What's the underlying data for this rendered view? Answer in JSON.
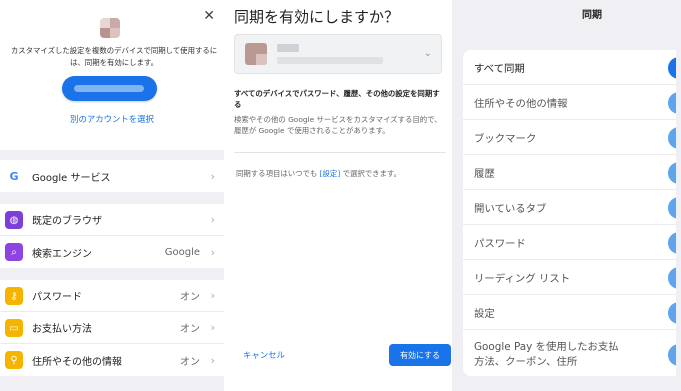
{
  "left": {
    "close_icon": "close-icon",
    "signin_text": "カスタマイズした設定を複数のデバイスで同期して使用するには、同期を有効にします。",
    "other_account": "別のアカウントを選択",
    "sections": [
      {
        "rows": [
          {
            "name": "google-services",
            "icon": "google-icon",
            "icon_glyph": "G",
            "icon_color": "#ffffff",
            "label": "Google サービス",
            "value": ""
          }
        ]
      },
      {
        "rows": [
          {
            "name": "default-browser",
            "icon": "browser-icon",
            "icon_glyph": "◍",
            "icon_color": "#7e3fd8",
            "label": "既定のブラウザ",
            "value": ""
          },
          {
            "name": "search-engine",
            "icon": "search-icon",
            "icon_glyph": "⌕",
            "icon_color": "#8e44e0",
            "label": "検索エンジン",
            "value": "Google"
          }
        ]
      },
      {
        "rows": [
          {
            "name": "passwords",
            "icon": "key-icon",
            "icon_glyph": "⚷",
            "icon_color": "#f4b400",
            "label": "パスワード",
            "value": "オン"
          },
          {
            "name": "payment-methods",
            "icon": "card-icon",
            "icon_glyph": "▭",
            "icon_color": "#f4b400",
            "label": "お支払い方法",
            "value": "オン"
          },
          {
            "name": "addresses",
            "icon": "location-pin-icon",
            "icon_glyph": "⚲",
            "icon_color": "#f4b400",
            "label": "住所やその他の情報",
            "value": "オン"
          }
        ]
      }
    ]
  },
  "dialog": {
    "title": "同期を有効にしますか？",
    "sync_bold": "すべてのデバイスでパスワード、履歴、その他の設定を同期する",
    "sync_desc": "検索やその他の Google サービスをカスタマイズする目的で、履歴が Google で使用されることがあります。",
    "note_prefix": "同期する項目はいつでも ",
    "note_link": "[設定]",
    "note_suffix": " で選択できます。",
    "cancel": "キャンセル",
    "enable": "有効にする"
  },
  "sync_settings": {
    "title": "同期",
    "items": [
      {
        "label": "すべて同期",
        "on": true,
        "strong": true
      },
      {
        "label": "住所やその他の情報",
        "on": true,
        "strong": false
      },
      {
        "label": "ブックマーク",
        "on": true,
        "strong": false
      },
      {
        "label": "履歴",
        "on": true,
        "strong": false
      },
      {
        "label": "開いているタブ",
        "on": true,
        "strong": false
      },
      {
        "label": "パスワード",
        "on": true,
        "strong": false
      },
      {
        "label": "リーディング リスト",
        "on": true,
        "strong": false
      },
      {
        "label": "設定",
        "on": true,
        "strong": false
      }
    ],
    "last_item_lines": [
      "Google Pay を使用したお支払",
      "方法、クーポン、住所"
    ],
    "colors": {
      "accent": "#1a73e8",
      "toggle_light": "#5ea5ee"
    }
  }
}
